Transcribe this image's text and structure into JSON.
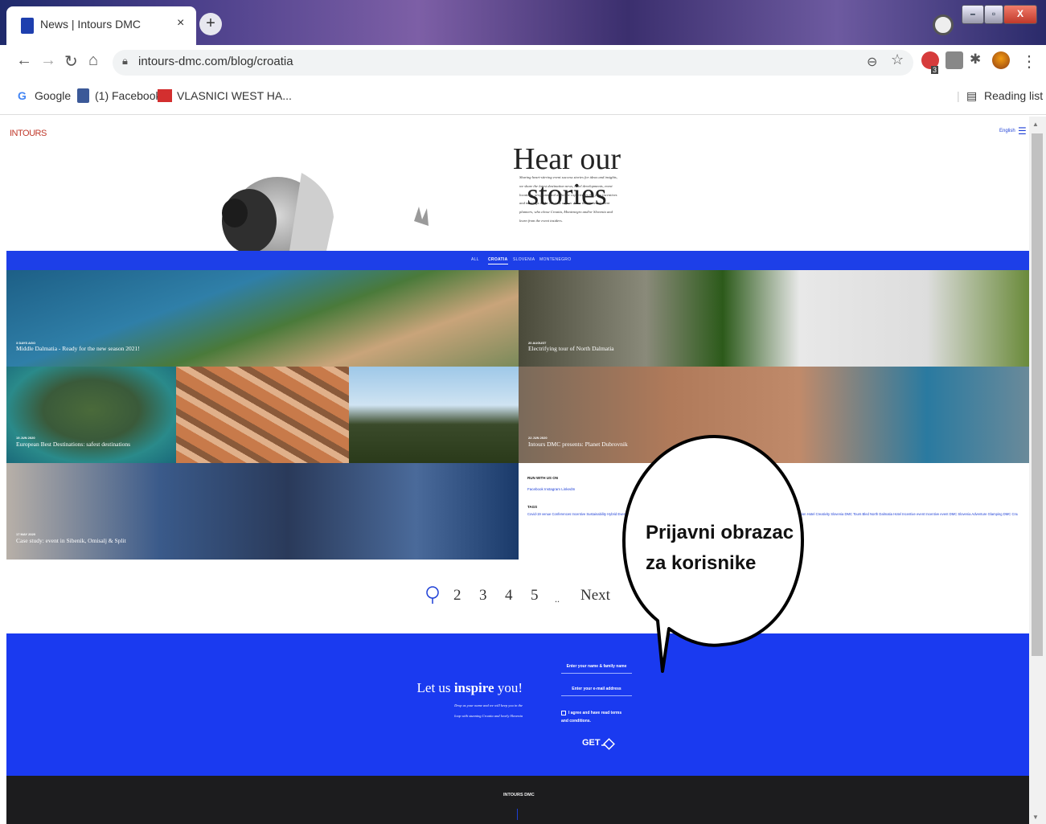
{
  "browser": {
    "tab_title": "News | Intours DMC",
    "tab_close": "×",
    "new_tab": "+",
    "url": "intours-dmc.com/blog/croatia",
    "bookmarks": [
      "Google",
      "(1) Facebook",
      "VLASNICI WEST HA..."
    ],
    "reading_list": "Reading list",
    "extension_badge": "3"
  },
  "site": {
    "logo": "INTOURS",
    "language": "English",
    "hero_title": "Hear our stories",
    "hero_text": "Sharing heart-stirring event success stories for ideas and insights, we share the latest destination news, hotel developments, event locations, programs and authentic experiences for your incentives and meetings in the Adriatic region. Hear the stories of event planners, who chose Croatia, Montenegro and/or Slovenia and learn from the event insiders.",
    "filters": [
      "ALL",
      "CROATIA",
      "SLOVENIA",
      "MONTENEGRO"
    ],
    "active_filter": "CROATIA"
  },
  "posts": [
    {
      "date": "3 DAYS AGO",
      "caption": "Middle Dalmatia - Ready for the new season 2021!"
    },
    {
      "date": "20 AUGUST",
      "caption": "Electrifying tour of North Dalmatia"
    },
    {
      "date": "19 JUN 2020",
      "caption": "European Best Destinations: safest destinations"
    },
    {
      "date": "22 JUN 2020",
      "caption": "Intours DMC presents: Planet Dubrovnik"
    },
    {
      "date": "17 MAY 2020",
      "caption": "Case study: event in Sibenik, Omisalj & Split"
    }
  ],
  "sidebar": {
    "run_with_us": "RUN WITH US ON",
    "social": "Facebook   Instagram   LinkedIn",
    "tags_heading": "TAGS",
    "tags": "Covid-19 venue  Conferences  Incentive  Sustainability  Hybrid Events  Dalmatia  Event management  Restaurant  Croatia  Special venue  Central Theme  Novelty  Special venue  Accommodation  Hotel  Creativity  Slovenia  DMC Tours  Bled  North Dalmatia  Hotel  Incentive event  Incentive event  DMC Slovenia  Adventure  Glamping  DMC Croatia  Dubrovnik  Split"
  },
  "pagination": {
    "pages": [
      "2",
      "3",
      "4",
      "5"
    ],
    "ellipsis": "..",
    "next": "Next"
  },
  "callout": {
    "text": "Prijavni obrazac za korisnike"
  },
  "newsletter": {
    "title_prefix": "Let us ",
    "title_bold": "inspire",
    "title_suffix": " you!",
    "subtitle": "Drop us your name and we will keep you in the loop with stunning Croatia and lovely Slovenia",
    "name_placeholder": "Enter your name & family name",
    "email_placeholder": "Enter your e-mail address",
    "agree_text": "I agree and have read terms and conditions.",
    "get_label": "GET"
  },
  "footer": {
    "name": "INTOURS DMC"
  }
}
